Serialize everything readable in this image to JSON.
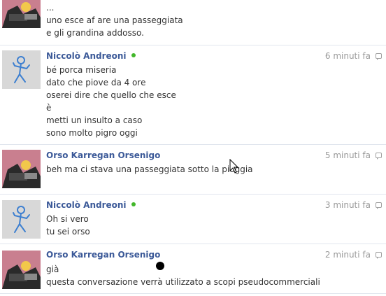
{
  "messages": [
    {
      "author": "",
      "online": false,
      "time": "",
      "lines": [
        "...",
        "uno esce af are una passeggiata",
        "e gli grandina addosso."
      ]
    },
    {
      "author": "Niccolò Andreoni",
      "online": true,
      "time": "6 minuti fa",
      "lines": [
        "bé porca miseria",
        "dato che piove da 4 ore",
        "oserei dire che quello che esce",
        "è",
        "metti un insulto a caso",
        "sono molto pigro oggi"
      ]
    },
    {
      "author": "Orso Karregan Orsenigo",
      "online": false,
      "time": "5 minuti fa",
      "lines": [
        "beh ma ci stava una passeggiata sotto la pioggia"
      ]
    },
    {
      "author": "Niccolò Andreoni",
      "online": true,
      "time": "3 minuti fa",
      "lines": [
        "Oh si vero",
        "tu sei orso"
      ]
    },
    {
      "author": "Orso Karregan Orsenigo",
      "online": false,
      "time": "2 minuti fa",
      "lines": [
        "già",
        "questa conversazione verrà utilizzato a scopi pseudocommerciali"
      ]
    }
  ]
}
